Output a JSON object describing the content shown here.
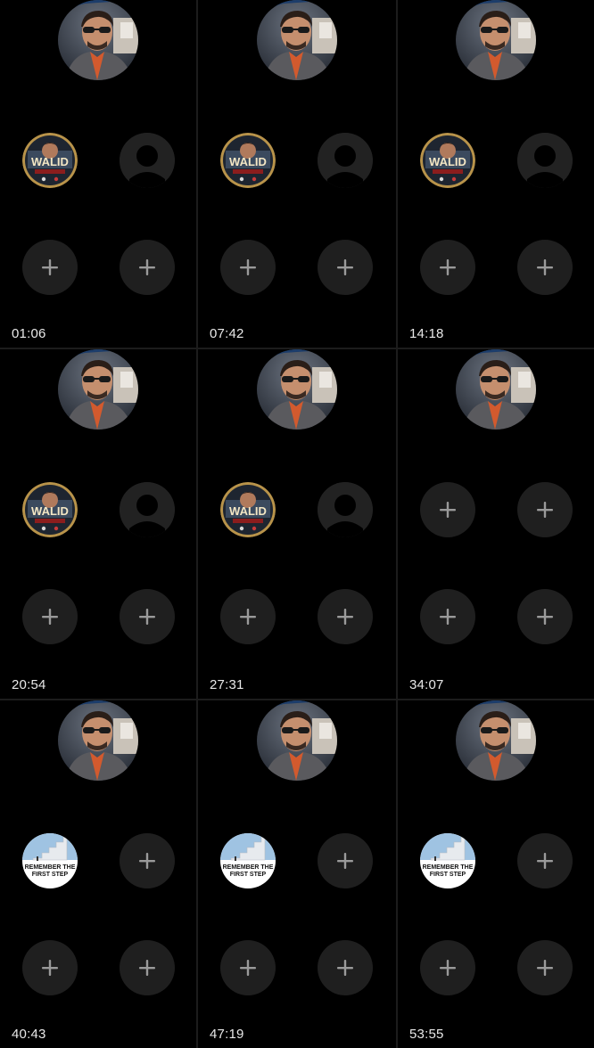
{
  "grid": {
    "cells": [
      {
        "timer": "01:06",
        "slots": [
          "walid",
          "empty-user",
          "add",
          "add"
        ]
      },
      {
        "timer": "07:42",
        "slots": [
          "walid",
          "empty-user",
          "add",
          "add"
        ]
      },
      {
        "timer": "14:18",
        "slots": [
          "walid",
          "empty-user",
          "add",
          "add"
        ]
      },
      {
        "timer": "20:54",
        "slots": [
          "walid",
          "empty-user",
          "add",
          "add"
        ]
      },
      {
        "timer": "27:31",
        "slots": [
          "walid",
          "empty-user",
          "add",
          "add"
        ]
      },
      {
        "timer": "34:07",
        "slots": [
          "add",
          "add",
          "add",
          "add"
        ]
      },
      {
        "timer": "40:43",
        "slots": [
          "steps",
          "add",
          "add",
          "add"
        ]
      },
      {
        "timer": "47:19",
        "slots": [
          "steps",
          "add",
          "add",
          "add"
        ]
      },
      {
        "timer": "53:55",
        "slots": [
          "steps",
          "add",
          "add",
          "add"
        ]
      }
    ]
  },
  "badges": {
    "walid": {
      "name": "WALID"
    },
    "steps": {
      "line1": "REMEMBER THE",
      "line2": "FIRST STEP"
    }
  },
  "icons": {
    "host": "host-avatar",
    "add": "plus-icon",
    "empty": "person-silhouette-icon"
  },
  "colors": {
    "background": "#000000",
    "slot": "#1f1f1f",
    "plus": "#9a9a9a",
    "timer": "#e9e9e9"
  }
}
